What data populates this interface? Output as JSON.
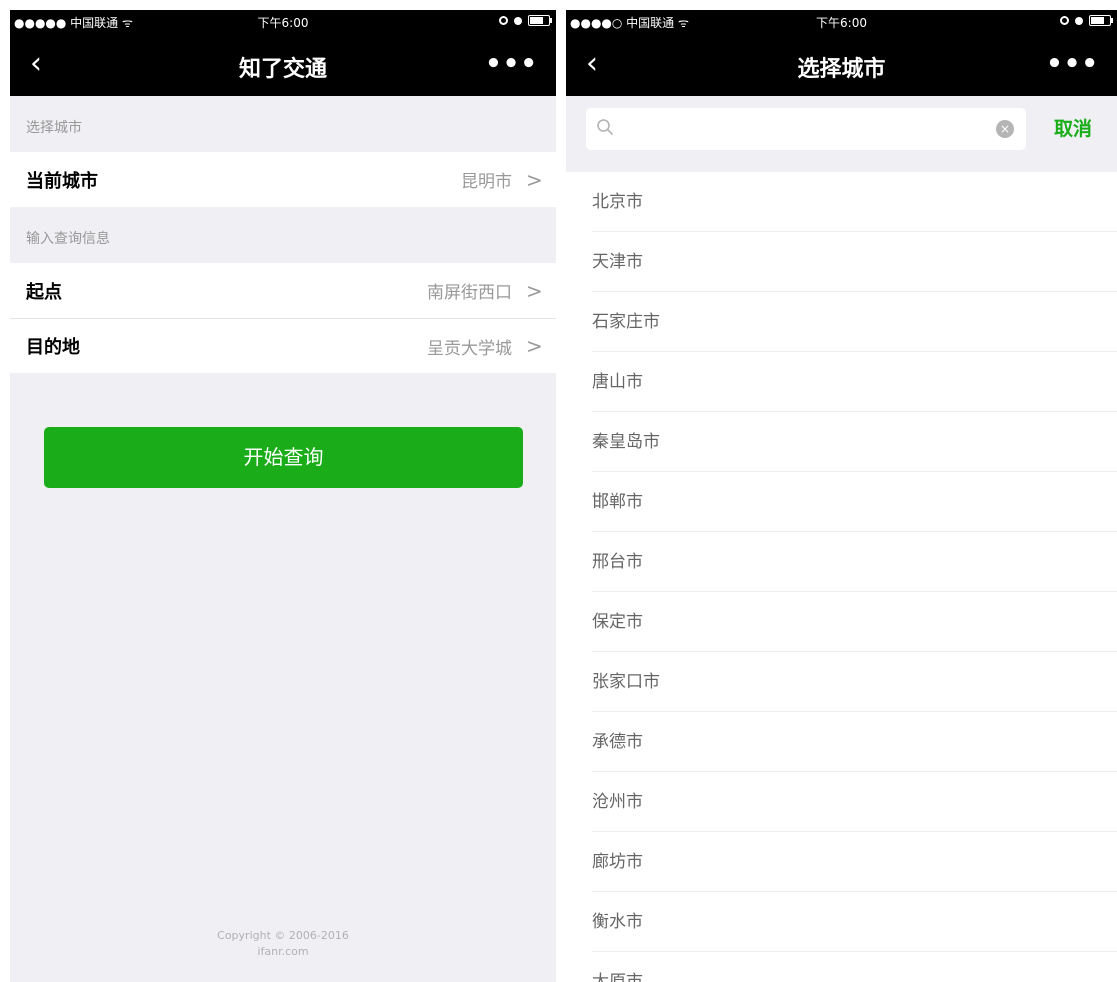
{
  "status_bar": {
    "left": {
      "carrier": "●●●●● 中国联通 ᯤ",
      "carrier_right": "●●●●○ 中国联通 ᯤ"
    },
    "time": "下午6:00",
    "battery_level": 0.7
  },
  "left_screen": {
    "nav": {
      "back_icon": "‹",
      "title": "知了交通",
      "more_icon": "•••"
    },
    "section_city": {
      "header": "选择城市",
      "current_city_label": "当前城市",
      "current_city_value": "昆明市"
    },
    "section_query": {
      "header": "输入查询信息",
      "start_label": "起点",
      "start_value": "南屏街西口",
      "destination_label": "目的地",
      "destination_value": "呈贡大学城"
    },
    "submit_label": "开始查询",
    "copyright_line1": "Copyright © 2006-2016",
    "copyright_line2": "ifanr.com"
  },
  "right_screen": {
    "nav": {
      "back_icon": "‹",
      "title": "选择城市",
      "more_icon": "•••"
    },
    "search": {
      "placeholder": "",
      "value": "",
      "clear_icon": "clear-icon",
      "cancel_label": "取消"
    },
    "cities": [
      "北京市",
      "天津市",
      "石家庄市",
      "唐山市",
      "秦皇岛市",
      "邯郸市",
      "邢台市",
      "保定市",
      "张家口市",
      "承德市",
      "沧州市",
      "廊坊市",
      "衡水市",
      "太原市"
    ]
  },
  "colors": {
    "accent": "#1aad19",
    "nav_bg": "#000000",
    "page_bg": "#efeff4"
  }
}
